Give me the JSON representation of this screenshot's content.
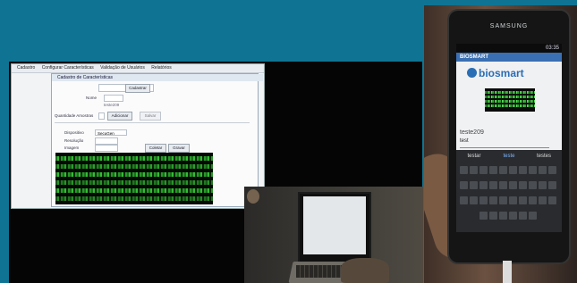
{
  "desktop": {
    "menu_bar": [
      "Cadastro",
      "Configurar Características",
      "Validação de Usuários",
      "Relatórios"
    ],
    "dialog_title": "Cadastro de Características",
    "fields": {
      "login_button": "Cadastrar",
      "name_label": "Nome",
      "name_value": "teste209",
      "quantity_label": "Quantidade Amostras",
      "collect_button": "Adicionar",
      "save_button": "Salvar",
      "sensor_label": "Dispositivo",
      "sensor_value": "SecuGen",
      "resolution_label": "Resolução",
      "image_label": "Imagem"
    },
    "dialog_buttons": [
      "Coletar",
      "Gravar"
    ]
  },
  "phone": {
    "brand": "SAMSUNG",
    "clock": "03:35",
    "app_title": "BIOSMART",
    "logo_text": "biosmart",
    "user_text": "teste209",
    "input_text": "test",
    "suggestions": [
      "testar",
      "teste",
      "testes"
    ]
  },
  "colors": {
    "background": "#0f7493",
    "fingerprint_green": "#36d236",
    "app_blue": "#2a6eb5"
  }
}
